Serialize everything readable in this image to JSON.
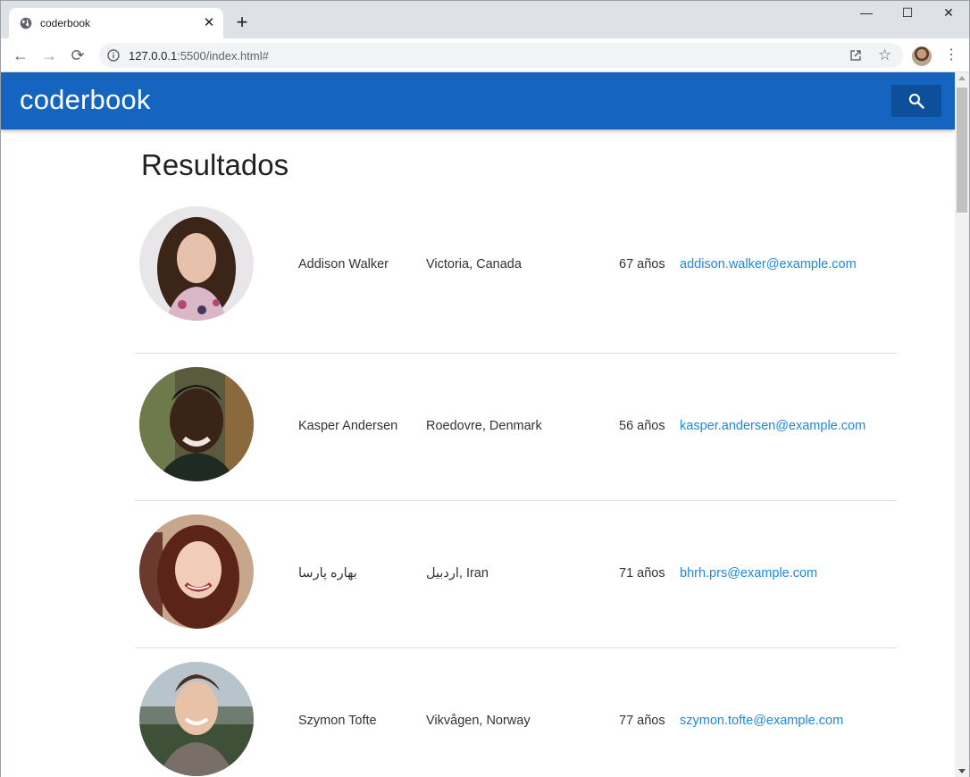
{
  "browser": {
    "tab_title": "coderbook",
    "url_host": "127.0.0.1",
    "url_path": ":5500/index.html#"
  },
  "app": {
    "brand": "coderbook",
    "accent_color": "#1565c0",
    "link_color": "#1e88e5"
  },
  "page": {
    "heading": "Resultados"
  },
  "results": [
    {
      "name": "Addison Walker",
      "location": "Victoria, Canada",
      "age": "67 años",
      "email": "addison.walker@example.com"
    },
    {
      "name": "Kasper Andersen",
      "location": "Roedovre, Denmark",
      "age": "56 años",
      "email": "kasper.andersen@example.com"
    },
    {
      "name": "بهاره پارسا",
      "location": "اردبیل, Iran",
      "age": "71 años",
      "email": "bhrh.prs@example.com"
    },
    {
      "name": "Szymon Tofte",
      "location": "Vikvågen, Norway",
      "age": "77 años",
      "email": "szymon.tofte@example.com"
    }
  ]
}
